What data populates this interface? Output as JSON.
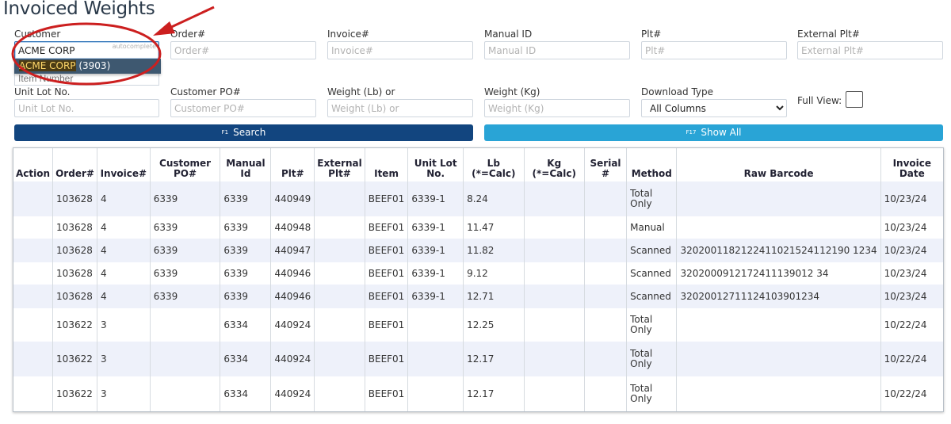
{
  "page_title": "Invoiced Weights",
  "filters": {
    "customer": {
      "label": "Customer",
      "value": "ACME CORP",
      "autocomplete_tag": "autocomplete"
    },
    "order": {
      "label": "Order#",
      "placeholder": "Order#"
    },
    "invoice": {
      "label": "Invoice#",
      "placeholder": "Invoice#"
    },
    "manual_id": {
      "label": "Manual ID",
      "placeholder": "Manual ID"
    },
    "plt": {
      "label": "Plt#",
      "placeholder": "Plt#"
    },
    "external_plt": {
      "label": "External Plt#",
      "placeholder": "External Plt#"
    },
    "item_number": {
      "placeholder": "Item Number"
    },
    "unit_lot": {
      "label": "Unit Lot No.",
      "placeholder": "Unit Lot No."
    },
    "customer_po": {
      "label": "Customer PO#",
      "placeholder": "Customer PO#"
    },
    "weight_lb": {
      "label": "Weight (Lb) or",
      "placeholder": "Weight (Lb) or"
    },
    "weight_kg": {
      "label": "Weight (Kg)",
      "placeholder": "Weight (Kg)"
    },
    "download_type": {
      "label": "Download Type",
      "selected": "All Columns"
    },
    "full_view": {
      "label": "Full View:"
    }
  },
  "autocomplete_dropdown": {
    "match": "ACME CORP",
    "suffix": " (3903)"
  },
  "buttons": {
    "search": {
      "key": "F1",
      "label": "Search"
    },
    "show_all": {
      "key": "F17",
      "label": "Show All"
    }
  },
  "colors": {
    "search_button": "#12457f",
    "show_all_button": "#29a4d6",
    "annotation": "#cc1f1f"
  },
  "table": {
    "headers": [
      "Action",
      "Order#",
      "Invoice#",
      "Customer PO#",
      "Manual Id",
      "Plt#",
      "External Plt#",
      "Item",
      "Unit Lot No.",
      "Lb (*=Calc)",
      "Kg (*=Calc)",
      "Serial #",
      "Method",
      "Raw Barcode",
      "Invoice Date"
    ],
    "rows": [
      [
        "",
        "103628",
        "4",
        "6339",
        "6339",
        "440949",
        "",
        "BEEF01",
        "6339-1",
        "8.24",
        "",
        "",
        "Total Only",
        "",
        "10/23/24"
      ],
      [
        "",
        "103628",
        "4",
        "6339",
        "6339",
        "440948",
        "",
        "BEEF01",
        "6339-1",
        "11.47",
        "",
        "",
        "Manual",
        "",
        "10/23/24"
      ],
      [
        "",
        "103628",
        "4",
        "6339",
        "6339",
        "440947",
        "",
        "BEEF01",
        "6339-1",
        "11.82",
        "",
        "",
        "Scanned",
        "3202001182122411021524112190 1234",
        "10/23/24"
      ],
      [
        "",
        "103628",
        "4",
        "6339",
        "6339",
        "440946",
        "",
        "BEEF01",
        "6339-1",
        "9.12",
        "",
        "",
        "Scanned",
        "3202000912172411139012 34",
        "10/23/24"
      ],
      [
        "",
        "103628",
        "4",
        "6339",
        "6339",
        "440946",
        "",
        "BEEF01",
        "6339-1",
        "12.71",
        "",
        "",
        "Scanned",
        "32020012711124103901234",
        "10/23/24"
      ],
      [
        "",
        "103622",
        "3",
        "",
        "6334",
        "440924",
        "",
        "BEEF01",
        "",
        "12.25",
        "",
        "",
        "Total Only",
        "",
        "10/22/24"
      ],
      [
        "",
        "103622",
        "3",
        "",
        "6334",
        "440924",
        "",
        "BEEF01",
        "",
        "12.17",
        "",
        "",
        "Total Only",
        "",
        "10/22/24"
      ],
      [
        "",
        "103622",
        "3",
        "",
        "6334",
        "440924",
        "",
        "BEEF01",
        "",
        "12.17",
        "",
        "",
        "Total Only",
        "",
        "10/22/24"
      ]
    ]
  }
}
